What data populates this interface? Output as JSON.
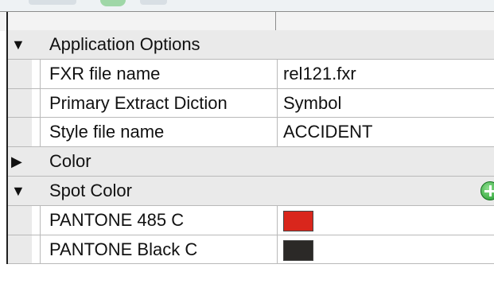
{
  "grid": {
    "categories": {
      "application_options": {
        "label": "Application Options",
        "expanded": true,
        "properties": [
          {
            "name": "FXR file name",
            "value": "rel121.fxr"
          },
          {
            "name": "Primary Extract Diction",
            "value": "Symbol"
          },
          {
            "name": "Style file name",
            "value": "ACCIDENT"
          }
        ]
      },
      "color": {
        "label": "Color",
        "expanded": false
      },
      "spot_color": {
        "label": "Spot Color",
        "expanded": true,
        "add_icon": "add-green-plus-icon",
        "properties": [
          {
            "name": "PANTONE 485 C",
            "swatch_color": "#d9261c"
          },
          {
            "name": "PANTONE Black C",
            "swatch_color": "#2b2927"
          }
        ]
      }
    }
  },
  "icons": {
    "expanded": "▼",
    "collapsed": "▶"
  }
}
